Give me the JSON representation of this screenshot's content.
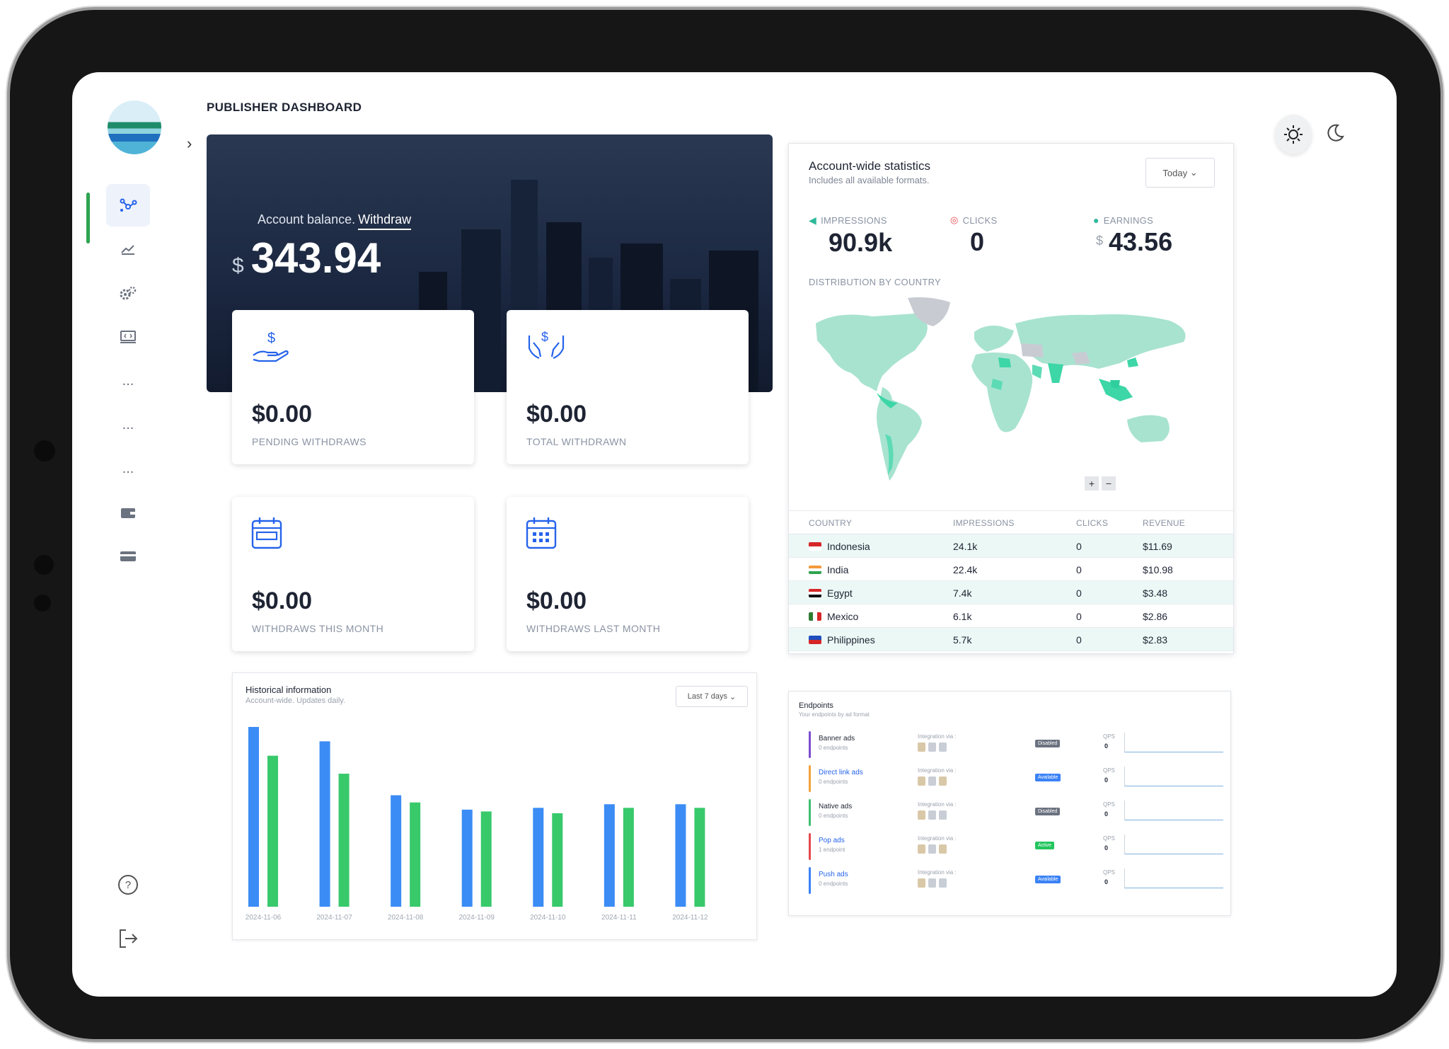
{
  "page": {
    "title": "PUBLISHER DASHBOARD"
  },
  "sidebar": {
    "items": [
      {
        "name": "network",
        "icon": "network-icon"
      },
      {
        "name": "statistics",
        "icon": "chart-icon"
      },
      {
        "name": "settings",
        "icon": "gears-icon"
      },
      {
        "name": "sites",
        "icon": "monitor-icon"
      },
      {
        "name": "more-1",
        "label": "..."
      },
      {
        "name": "more-2",
        "label": "..."
      },
      {
        "name": "more-3",
        "label": "..."
      },
      {
        "name": "wallet",
        "icon": "wallet-icon"
      },
      {
        "name": "payments",
        "icon": "card-icon"
      }
    ],
    "help_icon": "question-circle-icon",
    "logout_icon": "logout-icon"
  },
  "theme": {
    "light_icon": "sun-icon",
    "dark_icon": "moon-icon"
  },
  "balance": {
    "label": "Account balance.",
    "withdraw_link": "Withdraw",
    "currency": "$",
    "value": "343.94"
  },
  "cards": [
    {
      "amount": "$0.00",
      "label": "PENDING WITHDRAWS",
      "icon": "hand-dollar-icon"
    },
    {
      "amount": "$0.00",
      "label": "TOTAL WITHDRAWN",
      "icon": "hands-dollar-icon"
    },
    {
      "amount": "$0.00",
      "label": "WITHDRAWS THIS MONTH",
      "icon": "calendar-icon"
    },
    {
      "amount": "$0.00",
      "label": "WITHDRAWS LAST MONTH",
      "icon": "calendar-grid-icon"
    }
  ],
  "history": {
    "title": "Historical information",
    "subtitle": "Account-wide. Updates daily.",
    "range_select": "Last 7 days"
  },
  "chart_data": {
    "type": "bar",
    "categories": [
      "2024-11-06",
      "2024-11-07",
      "2024-11-08",
      "2024-11-09",
      "2024-11-10",
      "2024-11-11",
      "2024-11-12"
    ],
    "series": [
      {
        "color": "#3b8cf5",
        "values": [
          100,
          92,
          62,
          54,
          55,
          57,
          57
        ]
      },
      {
        "color": "#38c96b",
        "values": [
          84,
          74,
          58,
          53,
          52,
          55,
          55
        ]
      }
    ],
    "title": "",
    "xlabel": "",
    "ylabel": "",
    "ylim": [
      0,
      100
    ],
    "grid": false
  },
  "stats": {
    "title": "Account-wide statistics",
    "subtitle": "Includes all available formats.",
    "range_select": "Today",
    "impressions_label": "IMPRESSIONS",
    "impressions_value": "90.9k",
    "clicks_label": "CLICKS",
    "clicks_value": "0",
    "earnings_label": "EARNINGS",
    "earnings_currency": "$",
    "earnings_value": "43.56",
    "distribution_label": "DISTRIBUTION BY COUNTRY",
    "zoom_in": "+",
    "zoom_out": "−",
    "table": {
      "headers": [
        "COUNTRY",
        "IMPRESSIONS",
        "CLICKS",
        "REVENUE"
      ],
      "rows": [
        {
          "country": "Indonesia",
          "impressions": "24.1k",
          "clicks": "0",
          "revenue": "$11.69"
        },
        {
          "country": "India",
          "impressions": "22.4k",
          "clicks": "0",
          "revenue": "$10.98"
        },
        {
          "country": "Egypt",
          "impressions": "7.4k",
          "clicks": "0",
          "revenue": "$3.48"
        },
        {
          "country": "Mexico",
          "impressions": "6.1k",
          "clicks": "0",
          "revenue": "$2.86"
        },
        {
          "country": "Philippines",
          "impressions": "5.7k",
          "clicks": "0",
          "revenue": "$2.83"
        }
      ]
    }
  },
  "endpoints": {
    "title": "Endpoints",
    "subtitle": "Your endpoints by ad format",
    "integration_label": "Integration via :",
    "qps_label": "QPS",
    "rows": [
      {
        "name": "Banner ads",
        "count": "0 endpoints",
        "status": "Disabled",
        "qps": "0",
        "accent": "#7c4dd1",
        "link": false
      },
      {
        "name": "Direct link ads",
        "count": "0 endpoints",
        "status": "Available",
        "qps": "0",
        "accent": "#f2a23a",
        "link": true
      },
      {
        "name": "Native ads",
        "count": "0 endpoints",
        "status": "Disabled",
        "qps": "0",
        "accent": "#3fbf72",
        "link": false
      },
      {
        "name": "Pop ads",
        "count": "1 endpoint",
        "status": "Active",
        "qps": "0",
        "accent": "#e5484d",
        "link": true
      },
      {
        "name": "Push ads",
        "count": "0 endpoints",
        "status": "Available",
        "qps": "0",
        "accent": "#3b82f6",
        "link": true
      }
    ]
  }
}
